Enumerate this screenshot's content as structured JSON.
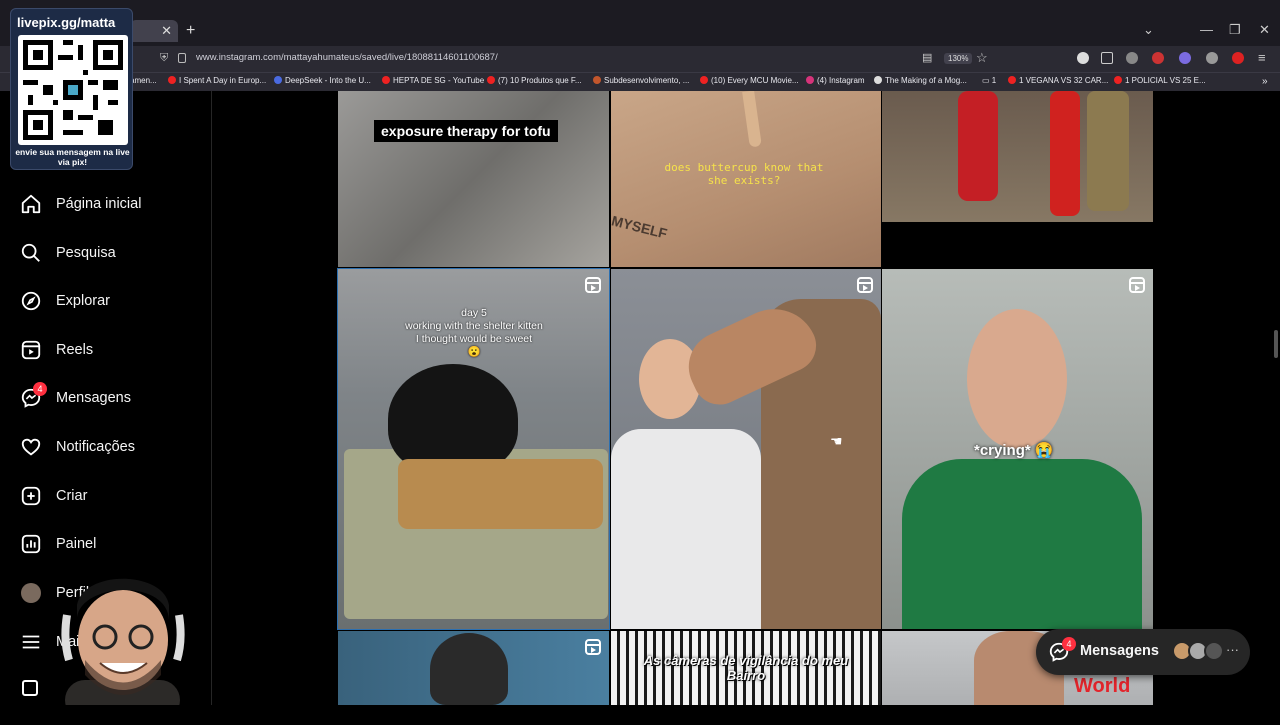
{
  "browser": {
    "url": "www.instagram.com/mattayahumateus/saved/live/18088114601100687/",
    "zoom": "130%",
    "bookmarks": [
      "amen...",
      "I Spent A Day in Europ...",
      "DeepSeek - Into the U...",
      "HEPTA DE SG - YouTube",
      "(7) 10 Produtos que F...",
      "Subdesenvolvimento, ...",
      "(10) Every MCU Movie...",
      "(4) Instagram",
      "The Making of a Mog...",
      "1",
      "1 VEGANA VS 32 CAR...",
      "1 POLICIAL VS 25 E..."
    ]
  },
  "overlay": {
    "title": "livepix.gg/matta",
    "subtitle": "envie sua mensagem na live via pix!"
  },
  "sidebar": {
    "items": [
      {
        "label": "Página inicial",
        "icon": "home-icon"
      },
      {
        "label": "Pesquisa",
        "icon": "search-icon"
      },
      {
        "label": "Explorar",
        "icon": "compass-icon"
      },
      {
        "label": "Reels",
        "icon": "reels-icon"
      },
      {
        "label": "Mensagens",
        "icon": "messenger-icon",
        "badge": "4"
      },
      {
        "label": "Notificações",
        "icon": "heart-icon"
      },
      {
        "label": "Criar",
        "icon": "plus-square-icon"
      },
      {
        "label": "Painel",
        "icon": "chart-icon"
      },
      {
        "label": "Perfil",
        "icon": "avatar"
      },
      {
        "label": "Mais",
        "icon": "menu-icon"
      }
    ]
  },
  "posts": [
    {
      "caption": "exposure therapy for tofu"
    },
    {
      "caption": "does buttercup know that she exists?",
      "tattoo": "MYSELF"
    },
    {
      "caption": ""
    },
    {
      "caption": "day 5\nworking with the shelter kitten\nI thought would be sweet\n😮"
    },
    {
      "caption": ""
    },
    {
      "caption": "*crying* 😭"
    },
    {
      "caption": ""
    },
    {
      "caption": "As câmeras de vigilância do meu Bairro"
    },
    {
      "caption": "World"
    }
  ],
  "messages_bar": {
    "label": "Mensagens",
    "badge": "4"
  },
  "colors": {
    "accent": "#ff3040",
    "background": "#000000",
    "panel": "#262626"
  }
}
